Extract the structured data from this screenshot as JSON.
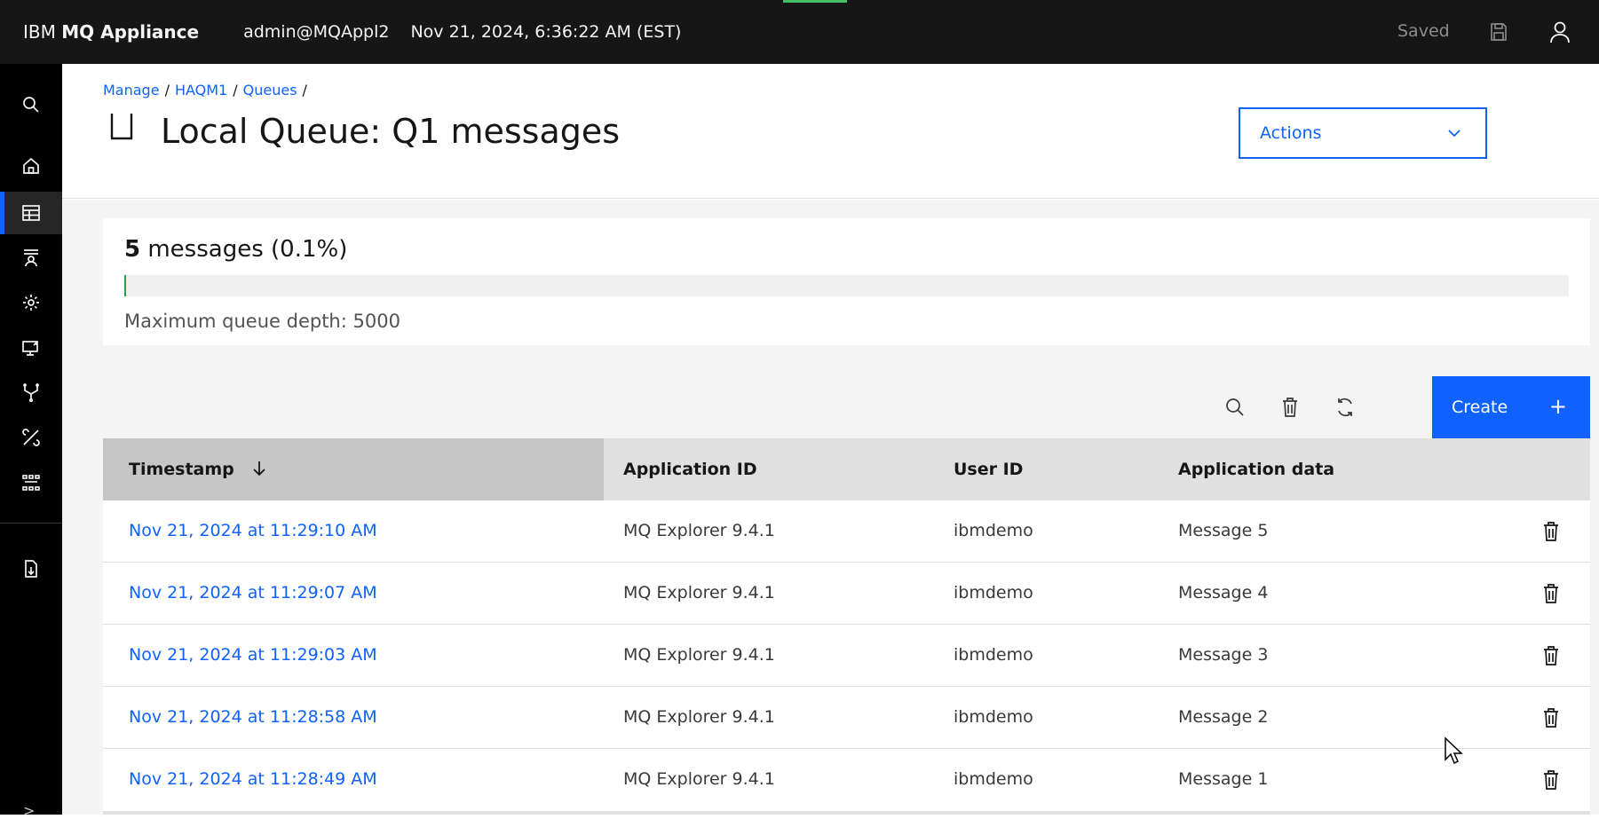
{
  "topbar": {
    "brand_prefix": "IBM ",
    "brand_name": "MQ Appliance",
    "user": "admin@MQAppl2",
    "datetime": "Nov 21, 2024, 6:36:22 AM (EST)",
    "saved_label": "Saved"
  },
  "sidenav": {
    "items": [
      "search-icon",
      "home-icon",
      "table-icon",
      "queue-manager-icon",
      "settings-icon",
      "monitor-icon",
      "network-icon",
      "tools-icon",
      "dataflow-icon",
      "export-icon"
    ],
    "active": "table-icon"
  },
  "breadcrumb": {
    "items": [
      "Manage",
      "HAQM1",
      "Queues"
    ],
    "separator": "/"
  },
  "page": {
    "title": "Local Queue: Q1 messages",
    "actions_label": "Actions"
  },
  "depth": {
    "count": "5",
    "count_suffix": " messages (0.1%)",
    "fill_fraction": 0.001,
    "max_label": "Maximum queue depth: 5000"
  },
  "toolbar": {
    "create_label": "Create",
    "create_plus": "+"
  },
  "table": {
    "columns": [
      "Timestamp",
      "Application ID",
      "User ID",
      "Application data"
    ],
    "sort_column": "Timestamp",
    "rows": [
      {
        "timestamp": "Nov 21, 2024 at 11:29:10 AM",
        "app_id": "MQ Explorer 9.4.1",
        "user_id": "ibmdemo",
        "app_data": "Message 5"
      },
      {
        "timestamp": "Nov 21, 2024 at 11:29:07 AM",
        "app_id": "MQ Explorer 9.4.1",
        "user_id": "ibmdemo",
        "app_data": "Message 4"
      },
      {
        "timestamp": "Nov 21, 2024 at 11:29:03 AM",
        "app_id": "MQ Explorer 9.4.1",
        "user_id": "ibmdemo",
        "app_data": "Message 3"
      },
      {
        "timestamp": "Nov 21, 2024 at 11:28:58 AM",
        "app_id": "MQ Explorer 9.4.1",
        "user_id": "ibmdemo",
        "app_data": "Message 2"
      },
      {
        "timestamp": "Nov 21, 2024 at 11:28:49 AM",
        "app_id": "MQ Explorer 9.4.1",
        "user_id": "ibmdemo",
        "app_data": "Message 1"
      }
    ]
  },
  "colors": {
    "accent": "#0f62fe",
    "progress": "#24a148",
    "topbar": "#161616",
    "sidenav": "#000000"
  }
}
